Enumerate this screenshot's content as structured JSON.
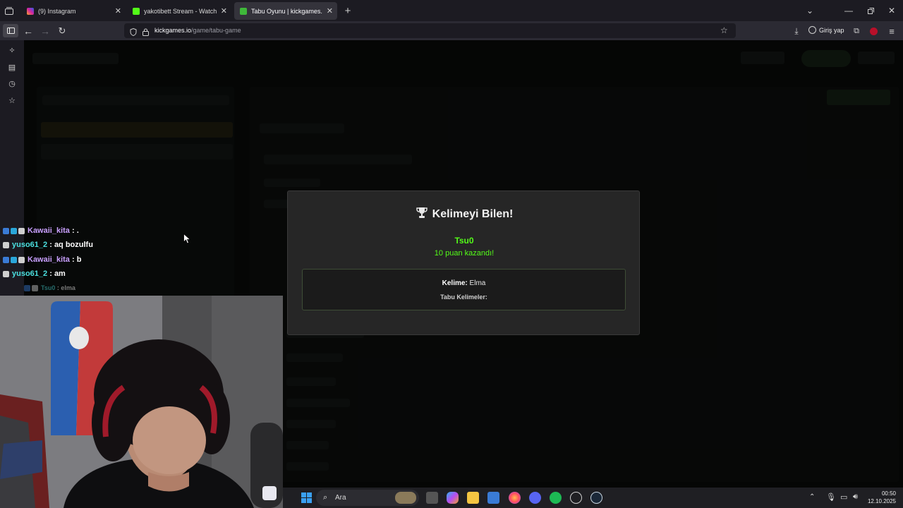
{
  "browser": {
    "tabs": [
      {
        "title": "(9) Instagram",
        "icon": "instagram-icon",
        "active": false
      },
      {
        "title": "yakotibett Stream - Watch Live",
        "icon": "kick-icon",
        "active": false
      },
      {
        "title": "Tabu Oyunu | kickgames.io",
        "icon": "kickgames-icon",
        "active": true
      }
    ],
    "new_tab": "+",
    "url_host": "kickgames.io",
    "url_path": "/game/tabu-game",
    "signin_label": "Giriş yap"
  },
  "modal": {
    "title": "Kelimeyi Bilen!",
    "winner": "Tsu0",
    "points_text": "10 puan kazandı!",
    "word_label": "Kelime:",
    "word_value": "Elma",
    "taboo_label": "Tabu Kelimeler:"
  },
  "chat": [
    {
      "user": "Kawaii_kita",
      "sep": " : ",
      "message": "."
    },
    {
      "user": "yuso61_2",
      "sep": " : ",
      "message": "aq bozulfu"
    },
    {
      "user": "Kawaii_kita",
      "sep": " : ",
      "message": "b"
    },
    {
      "user": "yuso61_2",
      "sep": " : ",
      "message": "am"
    },
    {
      "user": "Tsu0",
      "sep": " : ",
      "message": "elma"
    }
  ],
  "taskbar": {
    "search_placeholder": "Ara",
    "time": "00:50",
    "date": "12.10.2025"
  },
  "colors": {
    "accent": "#53fc18",
    "modal_bg": "#262626"
  }
}
